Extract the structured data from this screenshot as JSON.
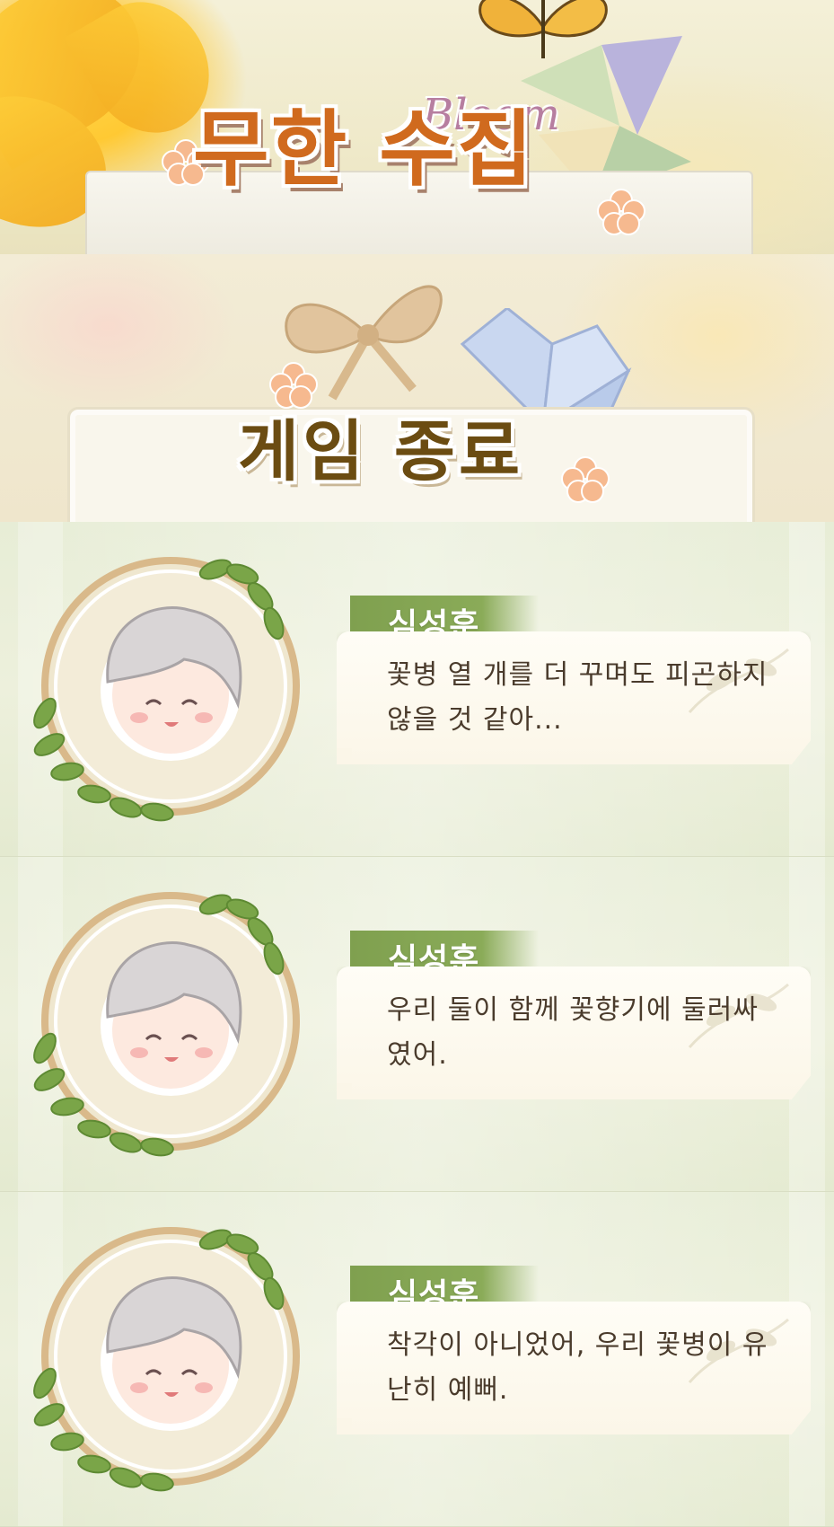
{
  "header": {
    "title": "무한 수집",
    "subtitle": "Bloom"
  },
  "game_over": {
    "title": "게임 종료"
  },
  "dialogs": [
    {
      "speaker": "심성훈",
      "line1": "꽃병 열 개를 더 꾸며도 피곤하지",
      "line2": "않을 것 같아..."
    },
    {
      "speaker": "심성훈",
      "line1": "우리 둘이 함께 꽃향기에 둘러싸",
      "line2": "였어."
    },
    {
      "speaker": "심성훈",
      "line1": "착각이 아니었어, 우리 꽃병이 유",
      "line2": "난히 예뻐."
    }
  ],
  "colors": {
    "title_orange": "#d06a1e",
    "game_over_brown": "#6b4c12",
    "name_tag_green": "#7fa04f",
    "bubble_text": "#4a3b2c"
  }
}
